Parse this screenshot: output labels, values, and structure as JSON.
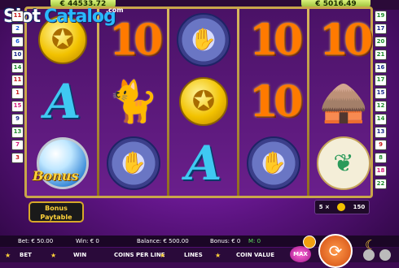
{
  "jackpots": {
    "left": "€ 44533.72",
    "right": "€ 5016.49"
  },
  "logo": {
    "slot": "Slot",
    "catalog": "Catalog",
    "suffix": ".com"
  },
  "paylines_left": [
    "11",
    "2",
    "6",
    "10",
    "14",
    "11",
    "1",
    "15",
    "9",
    "13",
    "7",
    "3"
  ],
  "paylines_right": [
    "19",
    "17",
    "20",
    "21",
    "16",
    "17",
    "15",
    "12",
    "14",
    "13",
    "9",
    "8",
    "18",
    "22"
  ],
  "reels_labels": {
    "bonus": "Bonus"
  },
  "paytable_button": {
    "line1": "Bonus",
    "line2": "Paytable"
  },
  "bonus_counter": {
    "mult": "5 ×",
    "value": "150"
  },
  "info": {
    "bet": "Bet: € 50.00",
    "win": "Win: € 0",
    "balance": "Balance: € 500.00",
    "bonus": "Bonus: € 0",
    "bonus_count": "M: 0"
  },
  "controls": {
    "bet": "BET",
    "win": "WIN",
    "coins_per_line": "COINS PER LINE",
    "lines": "LINES",
    "coin_value": "COIN VALUE",
    "max": "MAX"
  }
}
